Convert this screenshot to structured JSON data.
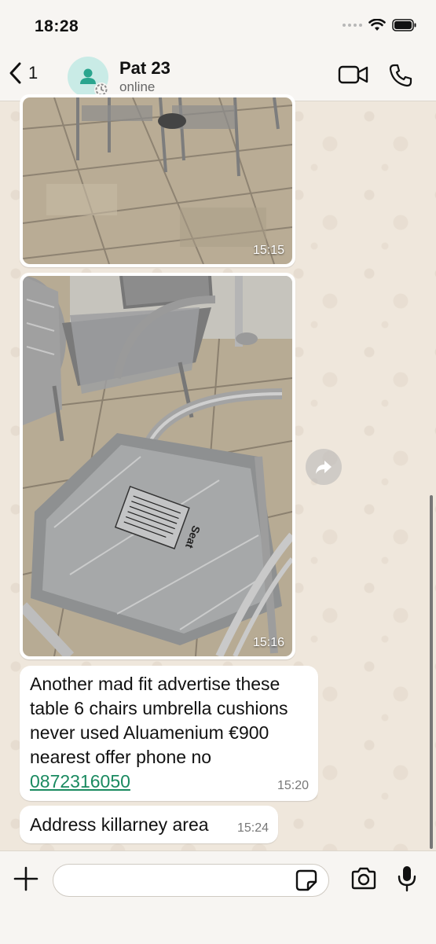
{
  "status_bar": {
    "time": "18:28"
  },
  "header": {
    "back_count": "1",
    "contact_name": "Pat 23",
    "contact_status": "online"
  },
  "messages": [
    {
      "type": "image",
      "description": "patio paving with chairs",
      "time": "15:15"
    },
    {
      "type": "image",
      "description": "garden chairs with wrapped seat cushions",
      "time": "15:16",
      "cushion_label": "Seat"
    },
    {
      "type": "text",
      "lines": [
        "Another mad fit advertise these",
        "table 6 chairs umbrella cushions",
        "never used Aluamenium €900",
        "nearest offer phone no"
      ],
      "link": "0872316050",
      "time": "15:20"
    },
    {
      "type": "text",
      "text": "Address killarney area",
      "time": "15:24"
    }
  ],
  "composer": {
    "placeholder": ""
  },
  "icons": {
    "back": "chevron-left-icon",
    "video": "video-camera-icon",
    "phone": "phone-icon",
    "forward": "forward-icon",
    "attach": "plus-icon",
    "sticker": "sticker-icon",
    "camera": "camera-icon",
    "mic": "microphone-icon"
  },
  "colors": {
    "link": "#1a8a60",
    "avatar_bg": "#c9ebe6",
    "avatar_fg": "#2aa58e",
    "wallpaper": "#efe7dc"
  }
}
